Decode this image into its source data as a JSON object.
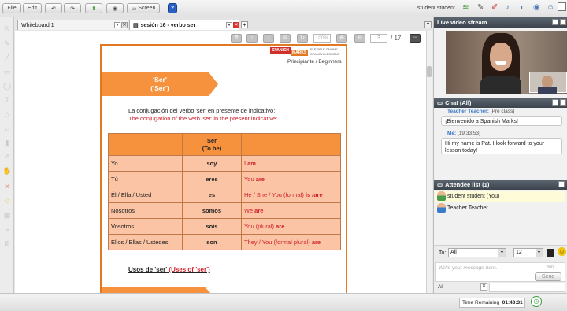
{
  "toolbar": {
    "file": "File",
    "edit": "Edit",
    "screen": "Screen",
    "help": "?"
  },
  "user": {
    "name": "student student"
  },
  "tabs": [
    {
      "label": "Whiteboard 1"
    },
    {
      "label": "sesión 16 - verbo ser"
    }
  ],
  "nav": {
    "zoom": "100%",
    "page": "3",
    "total": "/ 17"
  },
  "doc": {
    "logo_a": "SPANISH",
    "logo_b": "MARKS",
    "logo_c": "FLEXIBLE ONLINE",
    "logo_d": "SPANISH LESSONS",
    "level": "Principiante / Beginners",
    "banner_es": "'Ser'",
    "banner_en": "('Ser')",
    "intro_es": "La conjugación del verbo 'ser' en presente de indicativo:",
    "intro_en": "The conjugation of the verb 'ser' in the present indicative:",
    "table_header": "Ser",
    "table_header2": "(To be)",
    "rows": [
      {
        "pron": "Yo",
        "verb": "soy",
        "en1": "I ",
        "en2": "am"
      },
      {
        "pron": "Tú",
        "verb": "eres",
        "en1": "You ",
        "en2": "are"
      },
      {
        "pron": "Él / Ella / Usted",
        "verb": "es",
        "en1": "He / She / You (formal) ",
        "en2": "is /are"
      },
      {
        "pron": "Nosotros",
        "verb": "somos",
        "en1": "We ",
        "en2": "are"
      },
      {
        "pron": "Vosotros",
        "verb": "sois",
        "en1": "You (plural) ",
        "en2": "are"
      },
      {
        "pron": "Ellos / Ellas / Ustedes",
        "verb": "son",
        "en1": "They / You (formal plural) ",
        "en2": "are"
      }
    ],
    "usos_es": "Usos de 'ser'",
    "usos_en": "(Uses of 'ser')"
  },
  "video": {
    "title": "Live video stream"
  },
  "chat": {
    "title": "Chat (All)",
    "messages": [
      {
        "sender": "Teacher Teacher:",
        "meta": "[Pre class]",
        "text": "¡Bienvenido a Spanish Marks!"
      },
      {
        "sender": "Me:",
        "meta": "[19:33:53]",
        "text": "Hi my name is Pat. I look forward to your lesson today!"
      }
    ],
    "to_label": "To:",
    "to_value": "All",
    "font_size": "12",
    "placeholder": "Write your message here.",
    "counter": "300",
    "send": "Send",
    "filter": "All"
  },
  "attendees": {
    "title": "Attendee list (1)",
    "items": [
      {
        "name": "student student (You)"
      },
      {
        "name": "Teacher Teacher"
      }
    ]
  },
  "status": {
    "time_label": "Time Remaining",
    "time_value": "01:43:31"
  },
  "colors": {
    "header_bg": "#4a535d",
    "orange": "#f6913e",
    "salmon": "#fbc4a4",
    "red_text": "#d0232a"
  }
}
